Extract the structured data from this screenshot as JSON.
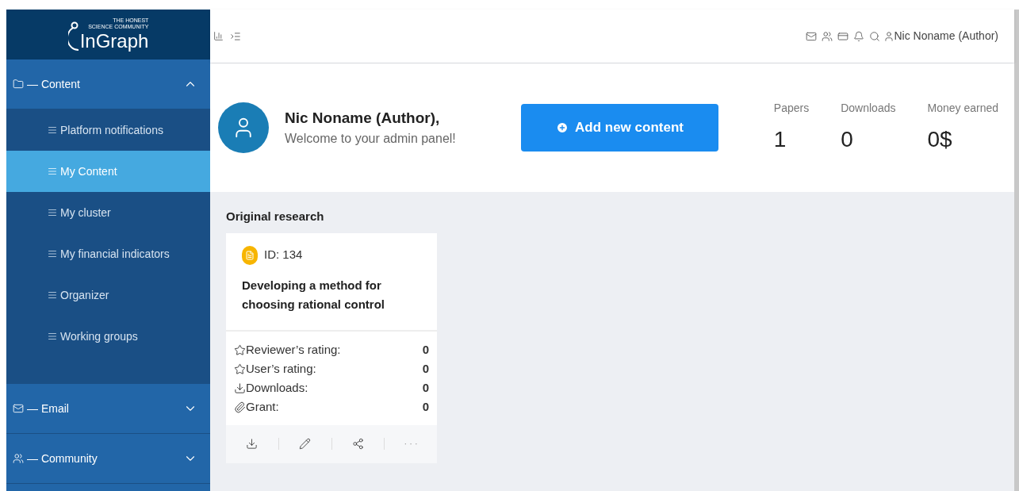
{
  "logo": {
    "name": "InGraph",
    "tagline_1": "THE HONEST",
    "tagline_2": "SCIENCE COMMUNITY"
  },
  "sidebar": {
    "groups": [
      {
        "label": "— Content",
        "kind": "folder",
        "expanded": true,
        "items": [
          {
            "label": "Platform notifications",
            "selected": false
          },
          {
            "label": "My Content",
            "selected": true
          },
          {
            "label": "My cluster",
            "selected": false
          },
          {
            "label": "My financial indicators",
            "selected": false
          },
          {
            "label": "Organizer",
            "selected": false
          },
          {
            "label": "Working groups",
            "selected": false
          }
        ]
      },
      {
        "label": "— Email",
        "kind": "mail",
        "expanded": false
      },
      {
        "label": "— Community",
        "kind": "people",
        "expanded": false
      }
    ]
  },
  "topbar": {
    "user": "Nic Noname (Author)"
  },
  "welcome": {
    "name": "Nic Noname (Author),",
    "message": "Welcome to your admin panel!",
    "button": "Add new content"
  },
  "stats": [
    {
      "label": "Papers",
      "value": "1"
    },
    {
      "label": "Downloads",
      "value": "0"
    },
    {
      "label": "Money earned",
      "value": "0$"
    }
  ],
  "section": {
    "title": "Original research"
  },
  "card": {
    "id": "ID: 134",
    "title": "Developing a method for choosing rational control",
    "metrics": [
      {
        "kind": "star",
        "label": "Reviewer’s rating:",
        "value": "0"
      },
      {
        "kind": "star",
        "label": "User’s rating:",
        "value": "0"
      },
      {
        "kind": "download",
        "label": "Downloads:",
        "value": "0"
      },
      {
        "kind": "clip",
        "label": "Grant:",
        "value": "0"
      }
    ],
    "more": "· · ·"
  }
}
